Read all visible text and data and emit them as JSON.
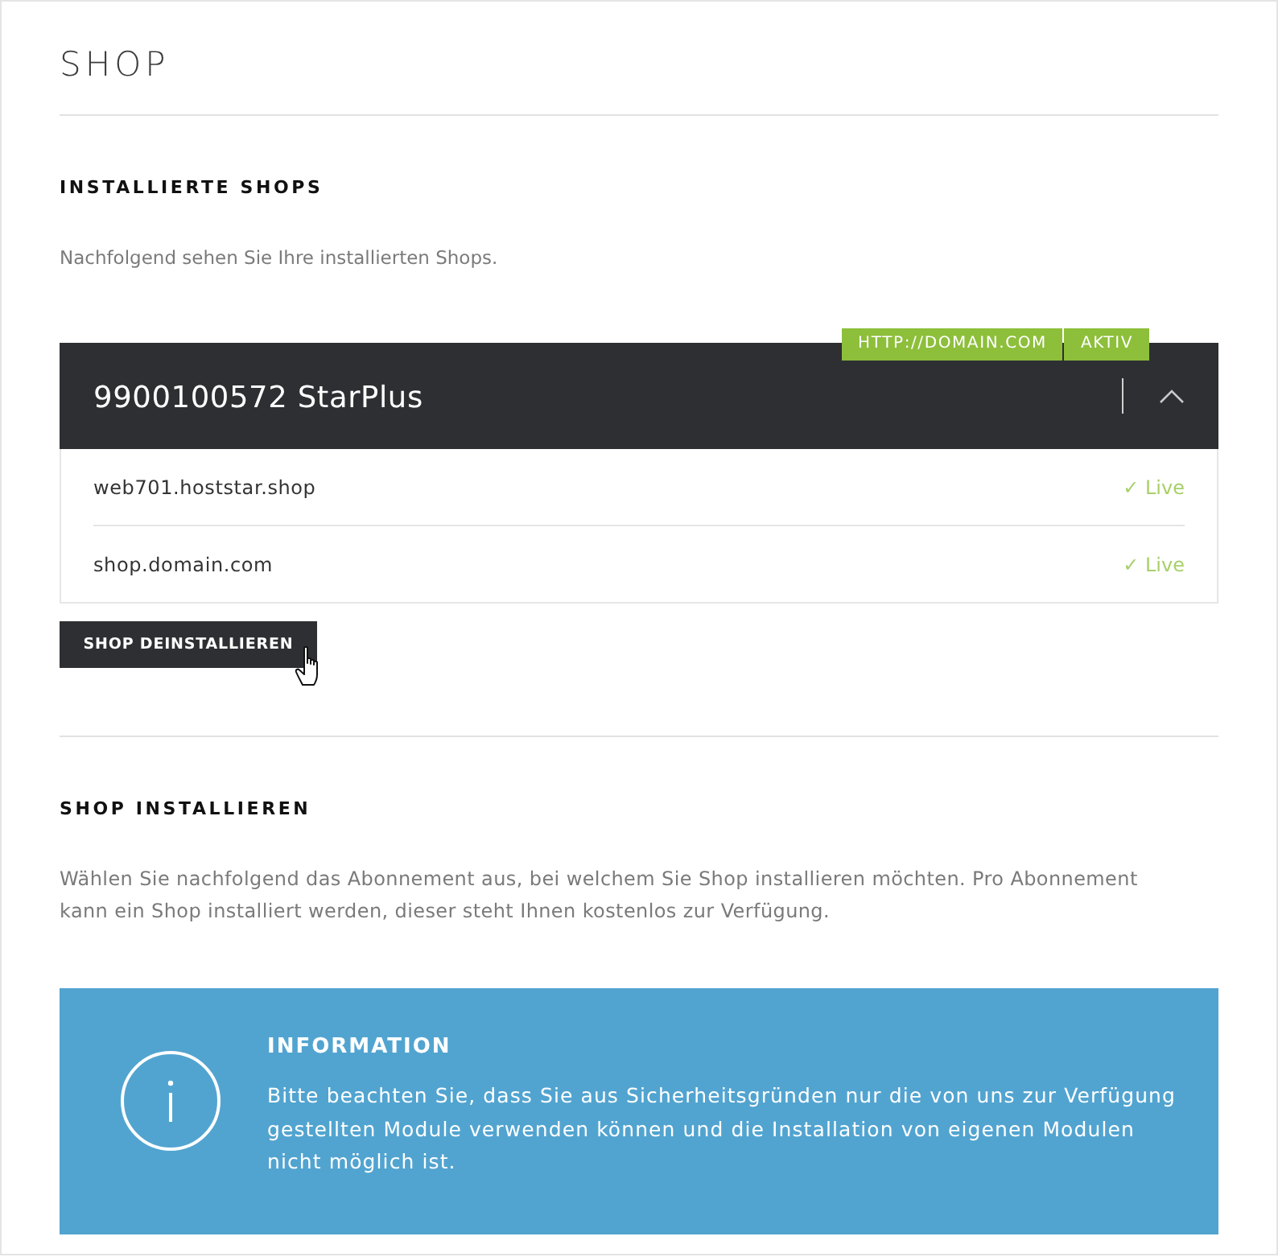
{
  "page": {
    "title": "SHOP"
  },
  "installed": {
    "heading": "INSTALLIERTE SHOPS",
    "description": "Nachfolgend sehen Sie Ihre installierten Shops.",
    "shops": [
      {
        "title": "9900100572 StarPlus",
        "tags": [
          "HTTP://DOMAIN.COM",
          "AKTIV"
        ],
        "expanded": true,
        "domains": [
          {
            "name": "web701.hoststar.shop",
            "status": "✓ Live"
          },
          {
            "name": "shop.domain.com",
            "status": "✓ Live"
          }
        ]
      }
    ],
    "uninstall_button": "SHOP DEINSTALLIEREN"
  },
  "install": {
    "heading": "SHOP INSTALLIEREN",
    "description": "Wählen Sie nachfolgend das Abonnement aus, bei welchem Sie Shop installieren möchten. Pro Abonnement kann ein Shop installiert werden, dieser steht Ihnen kostenlos zur Verfügung.",
    "info": {
      "title": "INFORMATION",
      "text": "Bitte beachten Sie, dass Sie aus Sicherheitsgründen nur die von uns zur Verfügung gestellten Module verwenden können und die Installation von eigenen Modulen nicht möglich ist."
    }
  }
}
